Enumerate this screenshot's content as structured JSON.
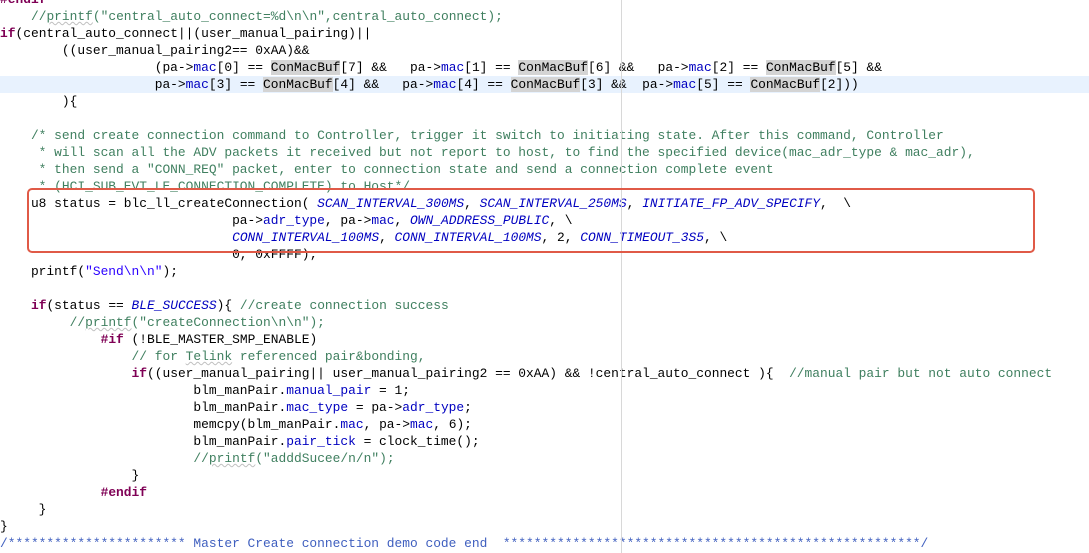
{
  "editor": {
    "language": "C",
    "lines": [
      [
        {
          "t": "#endif",
          "c": "pp"
        }
      ],
      [
        {
          "t": "    ",
          "c": ""
        },
        {
          "t": "//",
          "c": "c"
        },
        {
          "t": "printf",
          "c": "c u"
        },
        {
          "t": "(\"central_auto_connect=%d\\n\\n\",central_auto_connect);",
          "c": "c"
        }
      ],
      [
        {
          "t": "if",
          "c": "k"
        },
        {
          "t": "(central_auto_connect||(user_manual_pairing)||",
          "c": ""
        }
      ],
      [
        {
          "t": "        ((user_manual_pairing2== 0xAA)&&",
          "c": ""
        }
      ],
      [
        {
          "t": "                    (pa->",
          "c": ""
        },
        {
          "t": "mac",
          "c": "f"
        },
        {
          "t": "[0] == ",
          "c": ""
        },
        {
          "t": "ConMacBuf",
          "c": "occ"
        },
        {
          "t": "[7] &&   pa->",
          "c": ""
        },
        {
          "t": "mac",
          "c": "f"
        },
        {
          "t": "[1] == ",
          "c": ""
        },
        {
          "t": "ConMacBuf",
          "c": "occ"
        },
        {
          "t": "[6] &&   pa->",
          "c": ""
        },
        {
          "t": "mac",
          "c": "f"
        },
        {
          "t": "[2] == ",
          "c": ""
        },
        {
          "t": "ConMacBuf",
          "c": "occ"
        },
        {
          "t": "[5] &&",
          "c": ""
        }
      ],
      [
        {
          "t": "                    pa->",
          "c": ""
        },
        {
          "t": "mac",
          "c": "f"
        },
        {
          "t": "[3] == ",
          "c": ""
        },
        {
          "t": "ConMacBuf",
          "c": "occ"
        },
        {
          "t": "[4] &&   pa->",
          "c": ""
        },
        {
          "t": "mac",
          "c": "f"
        },
        {
          "t": "[4] == ",
          "c": ""
        },
        {
          "t": "ConMacBuf",
          "c": "occ"
        },
        {
          "t": "[3] &&  pa->",
          "c": ""
        },
        {
          "t": "mac",
          "c": "f"
        },
        {
          "t": "[5] == ",
          "c": ""
        },
        {
          "t": "ConMacBuf",
          "c": "occ"
        },
        {
          "t": "[2]))",
          "c": ""
        }
      ],
      [
        {
          "t": "        ){",
          "c": ""
        }
      ],
      [],
      [
        {
          "t": "    /* send create connection command to Controller, trigger it switch to initiating state. After this command, Controller",
          "c": "c"
        }
      ],
      [
        {
          "t": "     * will scan all the ADV packets it received but not report to host, to find the specified device(mac_adr_type & mac_adr),",
          "c": "c"
        }
      ],
      [
        {
          "t": "     * then send a \"CONN_REQ\" packet, enter to connection state and send a connection complete event",
          "c": "c"
        }
      ],
      [
        {
          "t": "     * (HCI_SUB_EVT_LE_CONNECTION_COMPLETE) to Host*/",
          "c": "c"
        }
      ],
      [
        {
          "t": "    u8 status = blc_ll_createConnection( ",
          "c": ""
        },
        {
          "t": "SCAN_INTERVAL_300MS",
          "c": "m"
        },
        {
          "t": ", ",
          "c": ""
        },
        {
          "t": "SCAN_INTERVAL_250MS",
          "c": "m"
        },
        {
          "t": ", ",
          "c": ""
        },
        {
          "t": "INITIATE_FP_ADV_SPECIFY",
          "c": "m"
        },
        {
          "t": ",  \\",
          "c": ""
        }
      ],
      [
        {
          "t": "                              pa->",
          "c": ""
        },
        {
          "t": "adr_type",
          "c": "f"
        },
        {
          "t": ", pa->",
          "c": ""
        },
        {
          "t": "mac",
          "c": "f"
        },
        {
          "t": ", ",
          "c": ""
        },
        {
          "t": "OWN_ADDRESS_PUBLIC",
          "c": "m"
        },
        {
          "t": ", \\",
          "c": ""
        }
      ],
      [
        {
          "t": "                              ",
          "c": ""
        },
        {
          "t": "CONN_INTERVAL_100MS",
          "c": "m"
        },
        {
          "t": ", ",
          "c": ""
        },
        {
          "t": "CONN_INTERVAL_100MS",
          "c": "m"
        },
        {
          "t": ", 2, ",
          "c": ""
        },
        {
          "t": "CONN_TIMEOUT_3S5",
          "c": "m"
        },
        {
          "t": ", \\",
          "c": ""
        }
      ],
      [
        {
          "t": "                              0, 0xFFFF);",
          "c": ""
        }
      ],
      [
        {
          "t": "    printf(",
          "c": ""
        },
        {
          "t": "\"Send\\n\\n\"",
          "c": "s"
        },
        {
          "t": ");",
          "c": ""
        }
      ],
      [],
      [
        {
          "t": "    ",
          "c": ""
        },
        {
          "t": "if",
          "c": "k"
        },
        {
          "t": "(status == ",
          "c": ""
        },
        {
          "t": "BLE_SUCCESS",
          "c": "m"
        },
        {
          "t": "){ ",
          "c": ""
        },
        {
          "t": "//create connection success",
          "c": "c"
        }
      ],
      [
        {
          "t": "         ",
          "c": ""
        },
        {
          "t": "//",
          "c": "c"
        },
        {
          "t": "printf",
          "c": "c u"
        },
        {
          "t": "(\"createConnection\\n\\n\");",
          "c": "c"
        }
      ],
      [
        {
          "t": "             ",
          "c": ""
        },
        {
          "t": "#if",
          "c": "pp"
        },
        {
          "t": " (!BLE_MASTER_SMP_ENABLE)",
          "c": ""
        }
      ],
      [
        {
          "t": "                 ",
          "c": ""
        },
        {
          "t": "// for ",
          "c": "c"
        },
        {
          "t": "Telink",
          "c": "c u"
        },
        {
          "t": " referenced pair&bonding,",
          "c": "c"
        }
      ],
      [
        {
          "t": "                 ",
          "c": ""
        },
        {
          "t": "if",
          "c": "k"
        },
        {
          "t": "((user_manual_pairing|| user_manual_pairing2 == 0xAA) && !central_auto_connect ){  ",
          "c": ""
        },
        {
          "t": "//manual pair but not auto connect",
          "c": "c"
        }
      ],
      [
        {
          "t": "                         blm_manPair.",
          "c": ""
        },
        {
          "t": "manual_pair",
          "c": "f"
        },
        {
          "t": " = 1;",
          "c": ""
        }
      ],
      [
        {
          "t": "                         blm_manPair.",
          "c": ""
        },
        {
          "t": "mac_type",
          "c": "f"
        },
        {
          "t": " = pa->",
          "c": ""
        },
        {
          "t": "adr_type",
          "c": "f"
        },
        {
          "t": ";",
          "c": ""
        }
      ],
      [
        {
          "t": "                         memcpy(blm_manPair.",
          "c": ""
        },
        {
          "t": "mac",
          "c": "f"
        },
        {
          "t": ", pa->",
          "c": ""
        },
        {
          "t": "mac",
          "c": "f"
        },
        {
          "t": ", 6);",
          "c": ""
        }
      ],
      [
        {
          "t": "                         blm_manPair.",
          "c": ""
        },
        {
          "t": "pair_tick",
          "c": "f"
        },
        {
          "t": " = clock_time();",
          "c": ""
        }
      ],
      [
        {
          "t": "                         ",
          "c": ""
        },
        {
          "t": "//",
          "c": "c"
        },
        {
          "t": "printf",
          "c": "c u"
        },
        {
          "t": "(\"adddSucee/n/n\");",
          "c": "c"
        }
      ],
      [
        {
          "t": "                 }",
          "c": ""
        }
      ],
      [
        {
          "t": "             ",
          "c": ""
        },
        {
          "t": "#endif",
          "c": "pp"
        }
      ],
      [
        {
          "t": "     }",
          "c": ""
        }
      ],
      [
        {
          "t": "}",
          "c": ""
        }
      ],
      [
        {
          "t": "/*********************** Master Create connection demo code end  ******************************************************/",
          "c": "cd"
        }
      ]
    ]
  },
  "current_line_index": 5,
  "colors": {
    "keyword": "#7f0055",
    "comment": "#3f7f5f",
    "field": "#0000c0",
    "string": "#2a00ff",
    "current_line": "#e8f2fe",
    "occurrence": "#d4d4d4",
    "callout_box": "#e05a47"
  }
}
